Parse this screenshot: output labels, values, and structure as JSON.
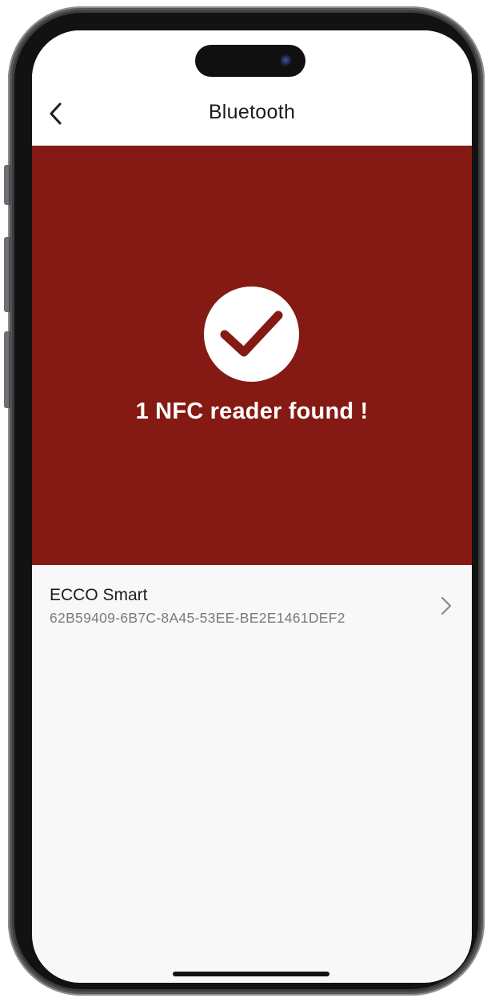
{
  "header": {
    "title": "Bluetooth",
    "back_icon": "chevron-left-icon"
  },
  "banner": {
    "background_color": "#841a13",
    "icon": "checkmark-circle-icon",
    "message": "1 NFC reader found !"
  },
  "devices": [
    {
      "name": "ECCO Smart",
      "id": "62B59409-6B7C-8A45-53EE-BE2E1461DEF2",
      "chevron_icon": "chevron-right-icon"
    }
  ]
}
